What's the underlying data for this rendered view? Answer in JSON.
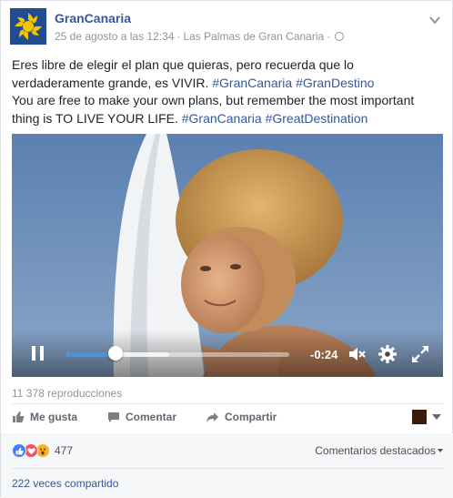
{
  "page": {
    "name": "GranCanaria",
    "date": "25 de agosto a las 12:34",
    "separator": "·",
    "location": "Las Palmas de Gran Canaria",
    "separator2": "·"
  },
  "post": {
    "es_text": "Eres libre de elegir el plan que quieras, pero recuerda que lo verdaderamente grande, es VIVIR.",
    "es_tags": [
      "#GranCanaria",
      "#GranDestino"
    ],
    "en_text": "You are free to make your own plans, but remember the most important thing is TO LIVE YOUR LIFE.",
    "en_tags": [
      "#GranCanaria",
      "#GreatDestination"
    ]
  },
  "video": {
    "time_remaining": "-0:24",
    "progress_fraction": 0.22,
    "buffered_fraction": 0.46,
    "icons": [
      "pause-icon",
      "volume-muted-icon",
      "gear-icon",
      "fullscreen-icon"
    ]
  },
  "stats": {
    "views": "11 378 reproducciones",
    "reaction_count": "477",
    "shares": "222 veces compartido"
  },
  "actions": {
    "like": "Me gusta",
    "comment": "Comentar",
    "share": "Compartir",
    "sort_label": "Comentarios destacados"
  },
  "colors": {
    "link": "#365899",
    "meta": "#90949c",
    "logo_bg": "#1f4d8f",
    "logo_fg": "#f5c400",
    "progress": "#4a90e2"
  }
}
